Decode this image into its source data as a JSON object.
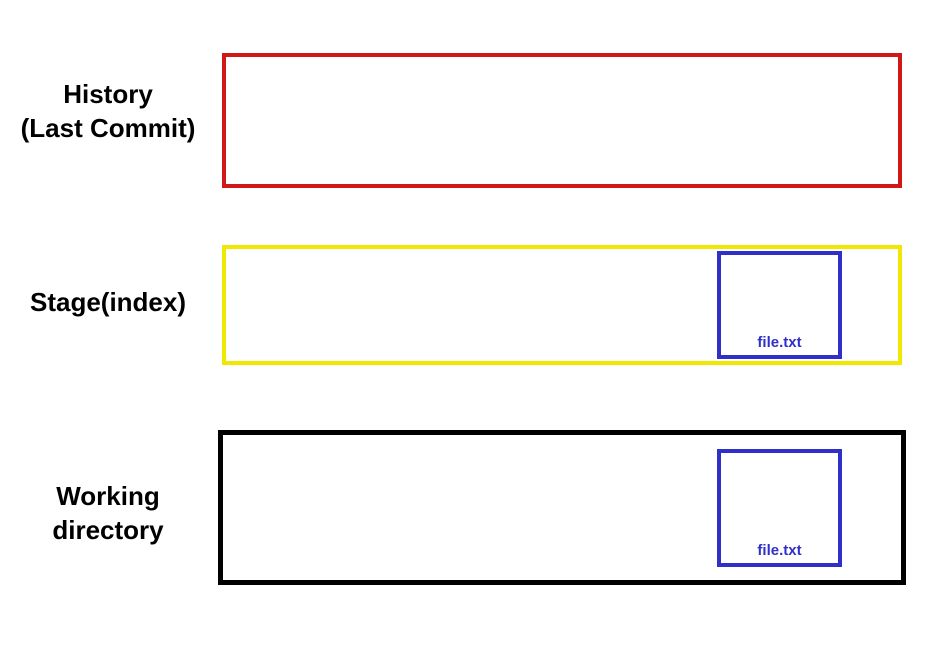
{
  "rows": {
    "history": {
      "label_line1": "History",
      "label_line2": "(Last Commit)",
      "border_color": "#d01818"
    },
    "stage": {
      "label": "Stage(index)",
      "border_color": "#f0e800",
      "file_label": "file.txt",
      "file_border_color": "#3030c8"
    },
    "working": {
      "label_line1": "Working",
      "label_line2": "directory",
      "border_color": "#000000",
      "file_label": "file.txt",
      "file_border_color": "#3030c8"
    }
  }
}
